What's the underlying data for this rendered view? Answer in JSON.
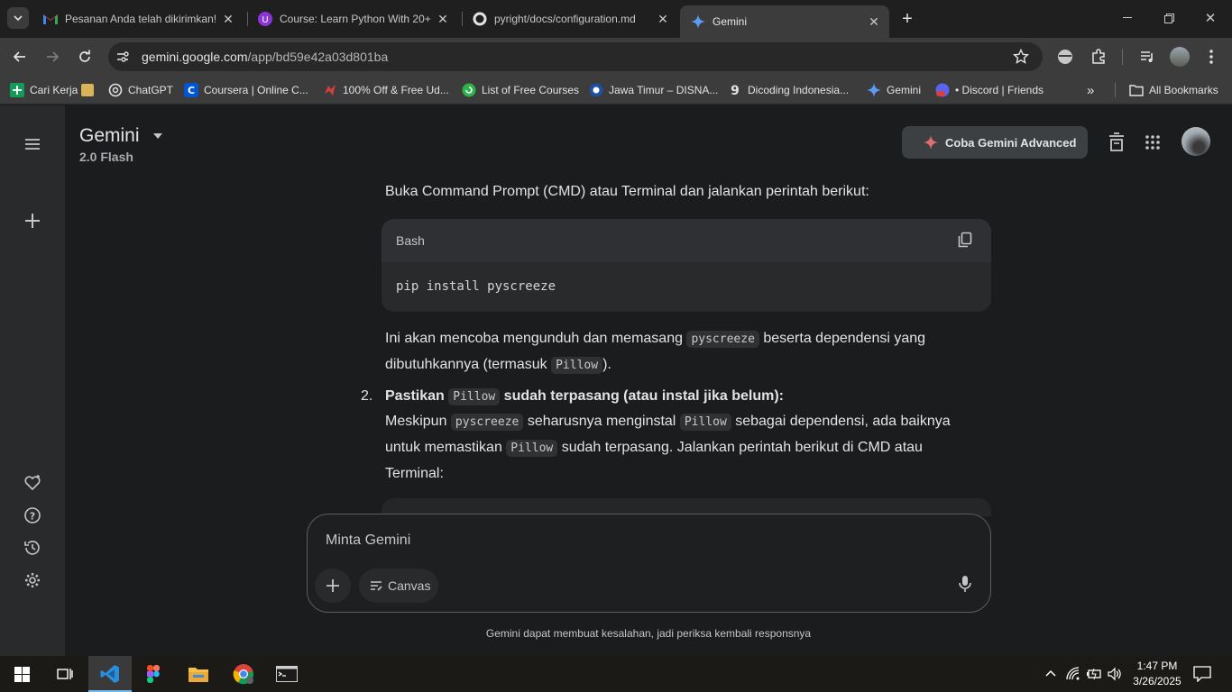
{
  "browser": {
    "tabs": [
      {
        "title": "Pesanan Anda telah dikirimkan!",
        "icon": "gmail-icon"
      },
      {
        "title": "Course: Learn Python With 20+",
        "icon": "udemy-icon"
      },
      {
        "title": "pyright/docs/configuration.md",
        "icon": "github-icon"
      },
      {
        "title": "Gemini",
        "icon": "gemini-icon",
        "active": true
      }
    ],
    "url_host": "gemini.google.com",
    "url_path": "/app/bd59e42a03d801ba",
    "bookmarks": [
      {
        "label": "Cari Kerja",
        "icon": "bookmark-green-icon"
      },
      {
        "label": "ChatGPT",
        "icon": "openai-icon"
      },
      {
        "label": "Coursera | Online C...",
        "icon": "coursera-icon"
      },
      {
        "label": "100% Off & Free Ud...",
        "icon": "dragon-icon"
      },
      {
        "label": "List of Free Courses",
        "icon": "green-circle-icon"
      },
      {
        "label": "Jawa Timur – DISNA...",
        "icon": "bluebird-icon"
      },
      {
        "label": "Dicoding Indonesia...",
        "icon": "dicoding-icon"
      },
      {
        "label": "Gemini",
        "icon": "gemini-icon"
      },
      {
        "label": "• Discord | Friends",
        "icon": "discord-icon"
      }
    ],
    "all_bookmarks_label": "All Bookmarks"
  },
  "gemini": {
    "title": "Gemini",
    "model": "2.0 Flash",
    "advanced_button": "Coba Gemini Advanced",
    "chat": {
      "intro": "Buka Command Prompt (CMD) atau Terminal dan jalankan perintah berikut:",
      "code_lang": "Bash",
      "code": "pip install pyscreeze",
      "para1_a": "Ini akan mencoba mengunduh dan memasang ",
      "para1_code1": "pyscreeze",
      "para1_b": " beserta dependensi yang",
      "para1_c": "dibutuhkannya (termasuk ",
      "para1_code2": "Pillow",
      "para1_d": ").",
      "item2_num": "2.",
      "item2_title_a": "Pastikan ",
      "item2_title_code": "Pillow",
      "item2_title_b": " sudah terpasang (atau instal jika belum):",
      "item2_l1_a": "Meskipun ",
      "item2_l1_code1": "pyscreeze",
      "item2_l1_b": " seharusnya menginstal ",
      "item2_l1_code2": "Pillow",
      "item2_l1_c": " sebagai dependensi, ada baiknya",
      "item2_l2_a": "untuk memastikan ",
      "item2_l2_code": "Pillow",
      "item2_l2_b": " sudah terpasang. Jalankan perintah berikut di CMD atau",
      "item2_l3": "Terminal:"
    },
    "composer_placeholder": "Minta Gemini",
    "canvas_label": "Canvas",
    "disclaimer": "Gemini dapat membuat kesalahan, jadi periksa kembali responsnya"
  },
  "taskbar": {
    "time": "1:47 PM",
    "date": "3/26/2025",
    "apps": [
      "start-icon",
      "task-view-icon",
      "vscode-icon",
      "figma-icon",
      "file-explorer-icon",
      "chrome-icon",
      "terminal-icon"
    ]
  },
  "colors": {
    "accent_blue": "#76b9ed",
    "gemini_red": "#e26d70"
  }
}
